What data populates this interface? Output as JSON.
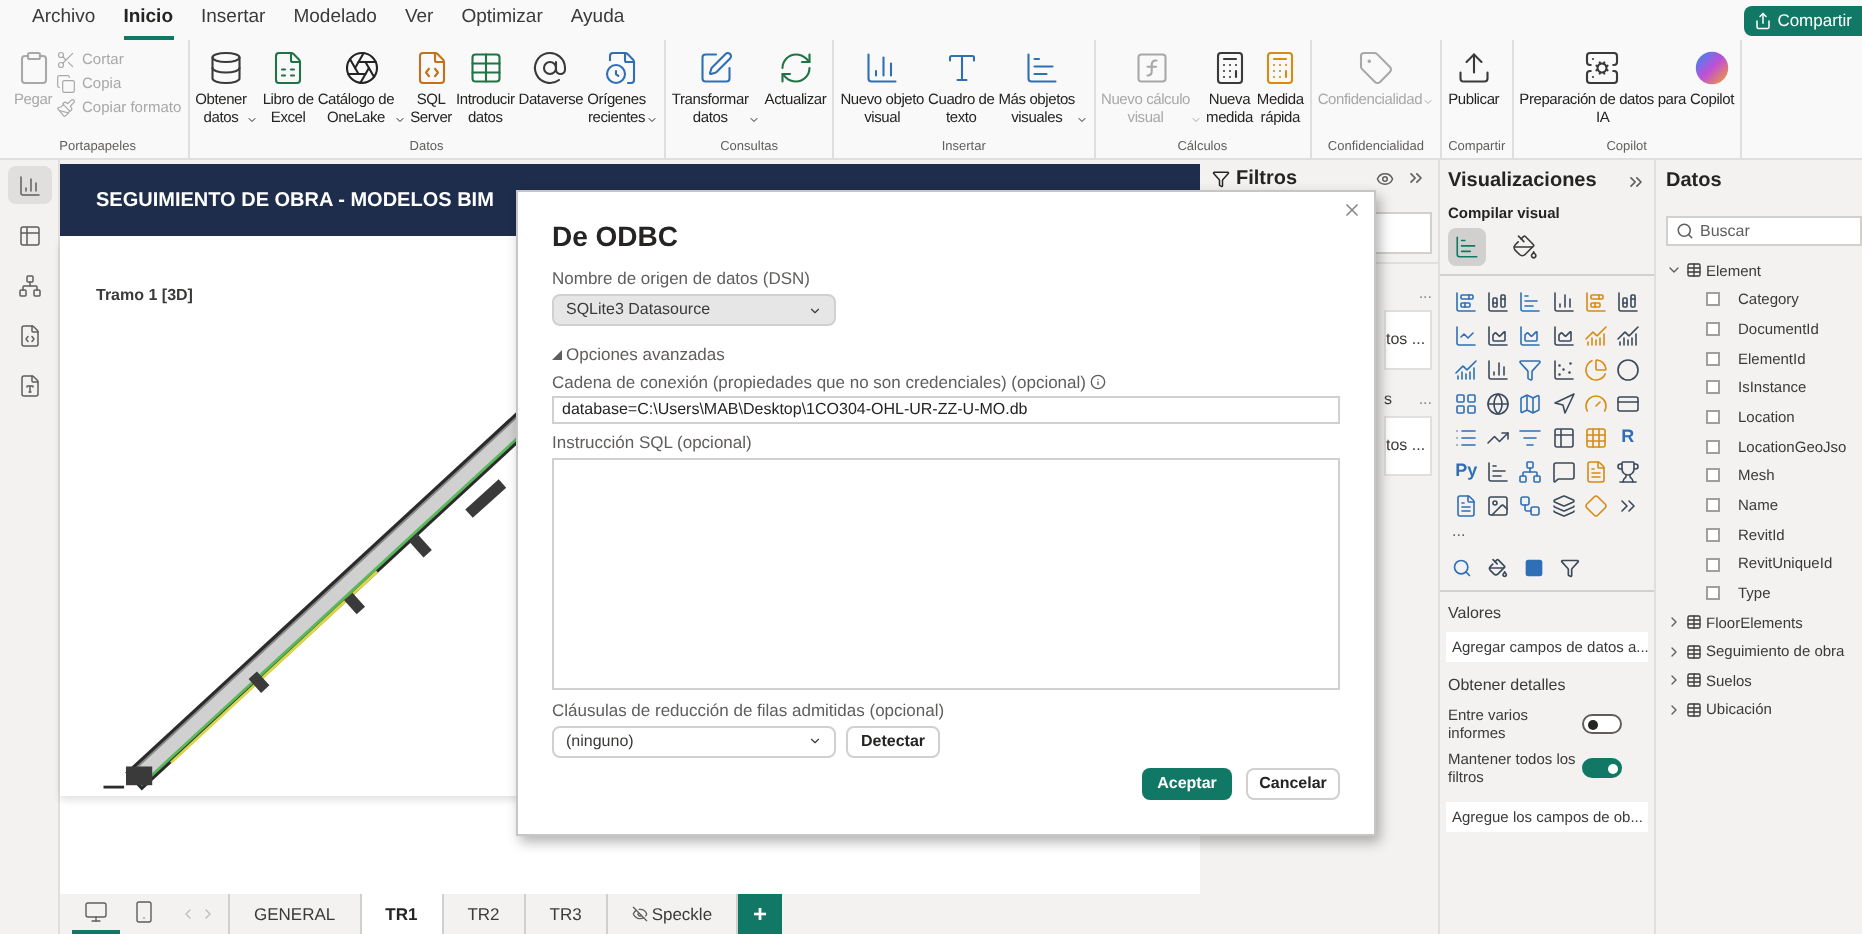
{
  "menu": {
    "tabs": [
      {
        "label": "Archivo",
        "selected": false
      },
      {
        "label": "Inicio",
        "selected": true
      },
      {
        "label": "Insertar",
        "selected": false
      },
      {
        "label": "Modelado",
        "selected": false
      },
      {
        "label": "Ver",
        "selected": false
      },
      {
        "label": "Optimizar",
        "selected": false
      },
      {
        "label": "Ayuda",
        "selected": false
      }
    ],
    "share_button": "Compartir"
  },
  "ribbon": {
    "groups": [
      {
        "label": "Portapapeles",
        "buttons": [
          {
            "kind": "large",
            "lines": [
              "Pegar"
            ],
            "dropdown": false,
            "disabled": true
          },
          {
            "kind": "small",
            "lines": [
              "Cortar"
            ],
            "dropdown": false,
            "disabled": true
          },
          {
            "kind": "small",
            "lines": [
              "Copia"
            ],
            "dropdown": false,
            "disabled": true
          },
          {
            "kind": "small",
            "lines": [
              "Copiar formato"
            ],
            "dropdown": false,
            "disabled": true
          }
        ]
      },
      {
        "label": "Datos",
        "buttons": [
          {
            "kind": "large",
            "lines": [
              "Obtener",
              "datos"
            ],
            "dropdown": true,
            "disabled": false
          },
          {
            "kind": "large",
            "lines": [
              "Libro de",
              "Excel"
            ],
            "dropdown": false,
            "disabled": false
          },
          {
            "kind": "large",
            "lines": [
              "Catálogo de",
              "OneLake"
            ],
            "dropdown": true,
            "disabled": false
          },
          {
            "kind": "large",
            "lines": [
              "SQL",
              "Server"
            ],
            "dropdown": false,
            "disabled": false
          },
          {
            "kind": "large",
            "lines": [
              "Introducir",
              "datos"
            ],
            "dropdown": false,
            "disabled": false
          },
          {
            "kind": "large",
            "lines": [
              "Dataverse"
            ],
            "dropdown": false,
            "disabled": false
          },
          {
            "kind": "large",
            "lines": [
              "Orígenes",
              "recientes"
            ],
            "dropdown": true,
            "disabled": false
          }
        ]
      },
      {
        "label": "Consultas",
        "buttons": [
          {
            "kind": "large",
            "lines": [
              "Transformar",
              "datos"
            ],
            "dropdown": true,
            "disabled": false
          },
          {
            "kind": "large",
            "lines": [
              "Actualizar"
            ],
            "dropdown": false,
            "disabled": false
          }
        ]
      },
      {
        "label": "Insertar",
        "buttons": [
          {
            "kind": "large",
            "lines": [
              "Nuevo objeto",
              "visual"
            ],
            "dropdown": false,
            "disabled": false
          },
          {
            "kind": "large",
            "lines": [
              "Cuadro de",
              "texto"
            ],
            "dropdown": false,
            "disabled": false
          },
          {
            "kind": "large",
            "lines": [
              "Más objetos",
              "visuales"
            ],
            "dropdown": true,
            "disabled": false
          }
        ]
      },
      {
        "label": "Cálculos",
        "buttons": [
          {
            "kind": "large",
            "lines": [
              "Nuevo cálculo",
              "visual"
            ],
            "dropdown": true,
            "disabled": true
          },
          {
            "kind": "large",
            "lines": [
              "Nueva",
              "medida"
            ],
            "dropdown": false,
            "disabled": false
          },
          {
            "kind": "large",
            "lines": [
              "Medida",
              "rápida"
            ],
            "dropdown": false,
            "disabled": false
          }
        ]
      },
      {
        "label": "Confidencialidad",
        "buttons": [
          {
            "kind": "large",
            "lines": [
              "Confidencialidad"
            ],
            "dropdown": true,
            "disabled": true
          }
        ]
      },
      {
        "label": "Compartir",
        "buttons": [
          {
            "kind": "large",
            "lines": [
              "Publicar"
            ],
            "dropdown": false,
            "disabled": false
          }
        ]
      },
      {
        "label": "Copilot",
        "buttons": [
          {
            "kind": "large",
            "lines": [
              "Preparación de datos para",
              "IA"
            ],
            "dropdown": false,
            "disabled": false
          },
          {
            "kind": "large",
            "lines": [
              "Copilot"
            ],
            "dropdown": false,
            "disabled": false
          }
        ]
      }
    ]
  },
  "left_rail": [
    {
      "kind": "report",
      "selected": true
    },
    {
      "kind": "table",
      "selected": false
    },
    {
      "kind": "model",
      "selected": false
    },
    {
      "kind": "dax",
      "selected": false
    },
    {
      "kind": "tmdl",
      "selected": false
    }
  ],
  "report": {
    "title": "SEGUIMIENTO DE OBRA - MODELOS BIM",
    "visual_title": "Tramo 1 [3D]"
  },
  "page_bar": {
    "views": [
      {
        "kind": "desktop",
        "selected": true
      },
      {
        "kind": "mobile",
        "selected": false
      }
    ],
    "pages": [
      {
        "label": "GENERAL",
        "selected": false,
        "hidden": false
      },
      {
        "label": "TR1",
        "selected": true,
        "hidden": false
      },
      {
        "label": "TR2",
        "selected": false,
        "hidden": false
      },
      {
        "label": "TR3",
        "selected": false,
        "hidden": false
      },
      {
        "label": "Speckle",
        "selected": false,
        "hidden": true
      }
    ],
    "add_page": "+"
  },
  "filters_pane": {
    "title": "Filtros",
    "sections": [
      {
        "more": "...",
        "card_text": "tos ..."
      },
      {
        "heading": "s",
        "more": "...",
        "card_text": "tos ..."
      }
    ]
  },
  "dialog": {
    "title": "De ODBC",
    "dsn_label": "Nombre de origen de datos (DSN)",
    "dsn_value": "SQLite3 Datasource",
    "advanced": {
      "label": "Opciones avanzadas",
      "expanded": true
    },
    "connection_label": "Cadena de conexión (propiedades que no son credenciales) (opcional)",
    "connection_value": "database=C:\\Users\\MAB\\Desktop\\1CO304-OHL-UR-ZZ-U-MO.db",
    "sql_label": "Instrucción SQL (opcional)",
    "clauses_label": "Cláusulas de reducción de filas admitidas (opcional)",
    "clauses_value": "(ninguno)",
    "detect_button": "Detectar",
    "ok_button": "Aceptar",
    "cancel_button": "Cancelar"
  },
  "visualizations": {
    "title": "Visualizaciones",
    "subtitle": "Compilar visual",
    "tabs": [
      {
        "kind": "build",
        "selected": true
      },
      {
        "kind": "format",
        "selected": false
      }
    ],
    "letter_icons": [
      "R",
      "Py"
    ],
    "more": "...",
    "values_label": "Valores",
    "values_hint": "Agregar campos de datos a...",
    "details_title": "Obtener detalles",
    "toggles": [
      {
        "label": "Entre varios informes",
        "on": false
      },
      {
        "label": "Mantener todos los filtros",
        "on": true
      }
    ],
    "details_hint": "Agregue los campos de ob..."
  },
  "data_pane": {
    "title": "Datos",
    "search_placeholder": "Buscar",
    "tables": [
      {
        "name": "Element",
        "expanded": true,
        "children": [
          {
            "name": "Category",
            "checked": false
          },
          {
            "name": "DocumentId",
            "checked": false
          },
          {
            "name": "ElementId",
            "checked": false
          },
          {
            "name": "IsInstance",
            "checked": false
          },
          {
            "name": "Location",
            "checked": false
          },
          {
            "name": "LocationGeoJso",
            "checked": false
          },
          {
            "name": "Mesh",
            "checked": false
          },
          {
            "name": "Name",
            "checked": false
          },
          {
            "name": "RevitId",
            "checked": false
          },
          {
            "name": "RevitUniqueId",
            "checked": false
          },
          {
            "name": "Type",
            "checked": false
          }
        ]
      },
      {
        "name": "FloorElements",
        "expanded": false
      },
      {
        "name": "Seguimiento de obra",
        "expanded": false
      },
      {
        "name": "Suelos",
        "expanded": false
      },
      {
        "name": "Ubicación",
        "expanded": false
      }
    ]
  }
}
